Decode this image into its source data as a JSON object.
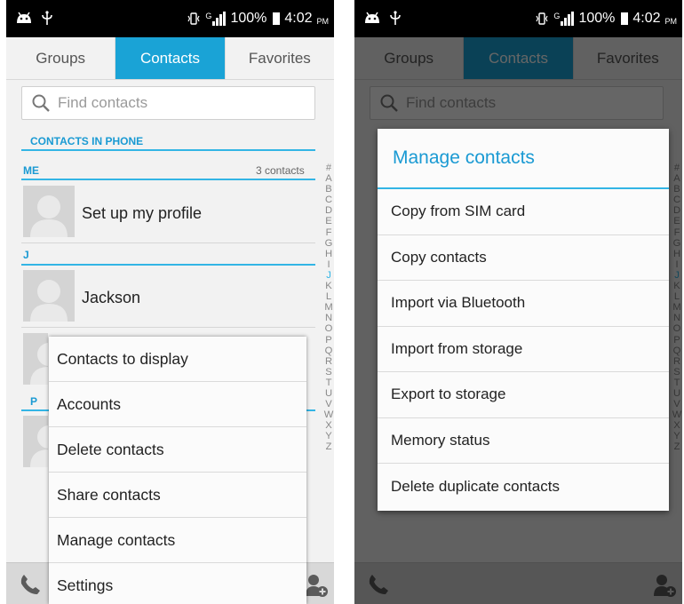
{
  "status_bar": {
    "signal_type": "G",
    "battery": "100%",
    "time": "4:02",
    "ampm": "PM"
  },
  "tabs": [
    {
      "label": "Groups"
    },
    {
      "label": "Contacts"
    },
    {
      "label": "Favorites"
    }
  ],
  "search": {
    "placeholder": "Find contacts"
  },
  "contacts": {
    "section_title": "CONTACTS IN PHONE",
    "me_label": "ME",
    "me_count": "3 contacts",
    "me_row": "Set up my profile",
    "groups": [
      {
        "letter": "J",
        "name": "Jackson"
      },
      {
        "letter": "P"
      }
    ]
  },
  "alphabet": [
    "#",
    "A",
    "B",
    "C",
    "D",
    "E",
    "F",
    "G",
    "H",
    "I",
    "J",
    "K",
    "L",
    "M",
    "N",
    "O",
    "P",
    "Q",
    "R",
    "S",
    "T",
    "U",
    "V",
    "W",
    "X",
    "Y",
    "Z"
  ],
  "highlighted_letter": "J",
  "menu": {
    "items": [
      {
        "label": "Contacts to display"
      },
      {
        "label": "Accounts"
      },
      {
        "label": "Delete contacts"
      },
      {
        "label": "Share contacts"
      },
      {
        "label": "Manage contacts"
      },
      {
        "label": "Settings"
      }
    ]
  },
  "dialog": {
    "title": "Manage contacts",
    "items": [
      {
        "label": "Copy from SIM card"
      },
      {
        "label": "Copy contacts"
      },
      {
        "label": "Import via Bluetooth"
      },
      {
        "label": "Import from storage"
      },
      {
        "label": "Export to storage"
      },
      {
        "label": "Memory status"
      },
      {
        "label": "Delete duplicate contacts"
      }
    ]
  },
  "colors": {
    "accent": "#33b5e5",
    "tab_active": "#1aa3d6",
    "statusbar": "#000000"
  },
  "icons": [
    "android-icon",
    "usb-icon",
    "vibrate-icon",
    "signal-icon",
    "battery-icon",
    "search-icon",
    "phone-icon",
    "add-person-icon"
  ]
}
